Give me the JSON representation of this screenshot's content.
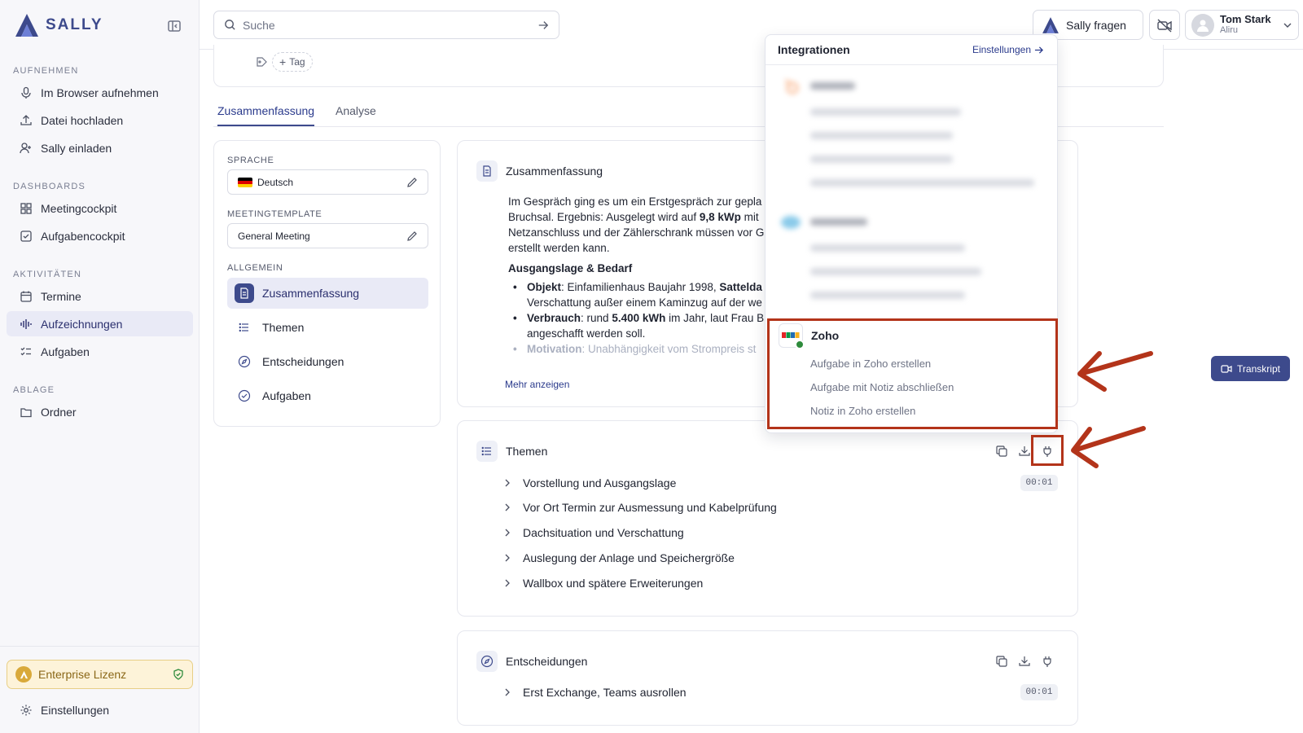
{
  "app": {
    "name": "SALLY"
  },
  "sidebar": {
    "sections": [
      {
        "title": "AUFNEHMEN",
        "items": [
          {
            "label": "Im Browser aufnehmen",
            "icon": "microphone-icon"
          },
          {
            "label": "Datei hochladen",
            "icon": "upload-icon"
          },
          {
            "label": "Sally einladen",
            "icon": "user-plus-icon"
          }
        ]
      },
      {
        "title": "DASHBOARDS",
        "items": [
          {
            "label": "Meetingcockpit",
            "icon": "grid-icon"
          },
          {
            "label": "Aufgabencockpit",
            "icon": "checkbox-icon"
          }
        ]
      },
      {
        "title": "AKTIVITÄTEN",
        "items": [
          {
            "label": "Termine",
            "icon": "calendar-icon"
          },
          {
            "label": "Aufzeichnungen",
            "icon": "waveform-icon",
            "active": true
          },
          {
            "label": "Aufgaben",
            "icon": "checklist-icon"
          }
        ]
      },
      {
        "title": "ABLAGE",
        "items": [
          {
            "label": "Ordner",
            "icon": "folder-icon"
          }
        ]
      }
    ],
    "license": "Enterprise Lizenz",
    "settings": "Einstellungen"
  },
  "topbar": {
    "search_placeholder": "Suche",
    "ask_label": "Sally fragen",
    "user_name": "Tom Stark",
    "user_org": "Aliru"
  },
  "header": {
    "tag_label": "Tag"
  },
  "tabs": [
    {
      "label": "Zusammenfassung",
      "active": true
    },
    {
      "label": "Analyse",
      "active": false
    }
  ],
  "left_panel": {
    "language_label": "SPRACHE",
    "language_value": "Deutsch",
    "template_label": "MEETINGTEMPLATE",
    "template_value": "General Meeting",
    "general_label": "ALLGEMEIN",
    "sections": [
      "Zusammenfassung",
      "Themen",
      "Entscheidungen",
      "Aufgaben"
    ]
  },
  "summary": {
    "title": "Zusammenfassung",
    "line1": "Im Gespräch ging es um ein Erstgespräch zur gepla",
    "line2a": "Bruchsal. Ergebnis: Ausgelegt wird auf ",
    "line2b": "9,8 kWp",
    "line2c": " mit",
    "line3": "Netzanschluss und der Zählerschrank müssen vor G",
    "line4": "erstellt werden kann.",
    "subheading": "Ausgangslage & Bedarf",
    "b1_label": "Objekt",
    "b1_text": ": Einfamilienhaus Baujahr 1998, ",
    "b1_bold": "Satteldа",
    "b1_cont": "Verschattung außer einem Kaminzug auf der we",
    "b2_label": "Verbrauch",
    "b2_text": ": rund ",
    "b2_bold": "5.400 kWh",
    "b2_rest": " im Jahr, laut Frau Bi",
    "b2_cont": "angeschafft werden soll.",
    "b3_label": "Motivation",
    "b3_text": ": Unabhängigkeit vom Strompreis st",
    "more": "Mehr anzeigen"
  },
  "themes": {
    "title": "Themen",
    "time": "00:01",
    "items": [
      "Vorstellung und Ausgangslage",
      "Vor Ort Termin zur Ausmessung und Kabelprüfung",
      "Dachsituation und Verschattung",
      "Auslegung der Anlage und Speichergröße",
      "Wallbox und spätere Erweiterungen"
    ]
  },
  "decisions": {
    "title": "Entscheidungen",
    "time": "00:01",
    "items": [
      "Erst Exchange, Teams ausrollen"
    ]
  },
  "transkript_label": "Transkript",
  "integrations": {
    "title": "Integrationen",
    "settings": "Einstellungen",
    "zoho": {
      "name": "Zoho",
      "actions": [
        "Aufgabe in Zoho erstellen",
        "Aufgabe mit Notiz abschließen",
        "Notiz in Zoho erstellen"
      ]
    }
  },
  "colors": {
    "accent": "#3d4a8c",
    "highlight": "#b3341a",
    "license": "#fdf3d9"
  }
}
